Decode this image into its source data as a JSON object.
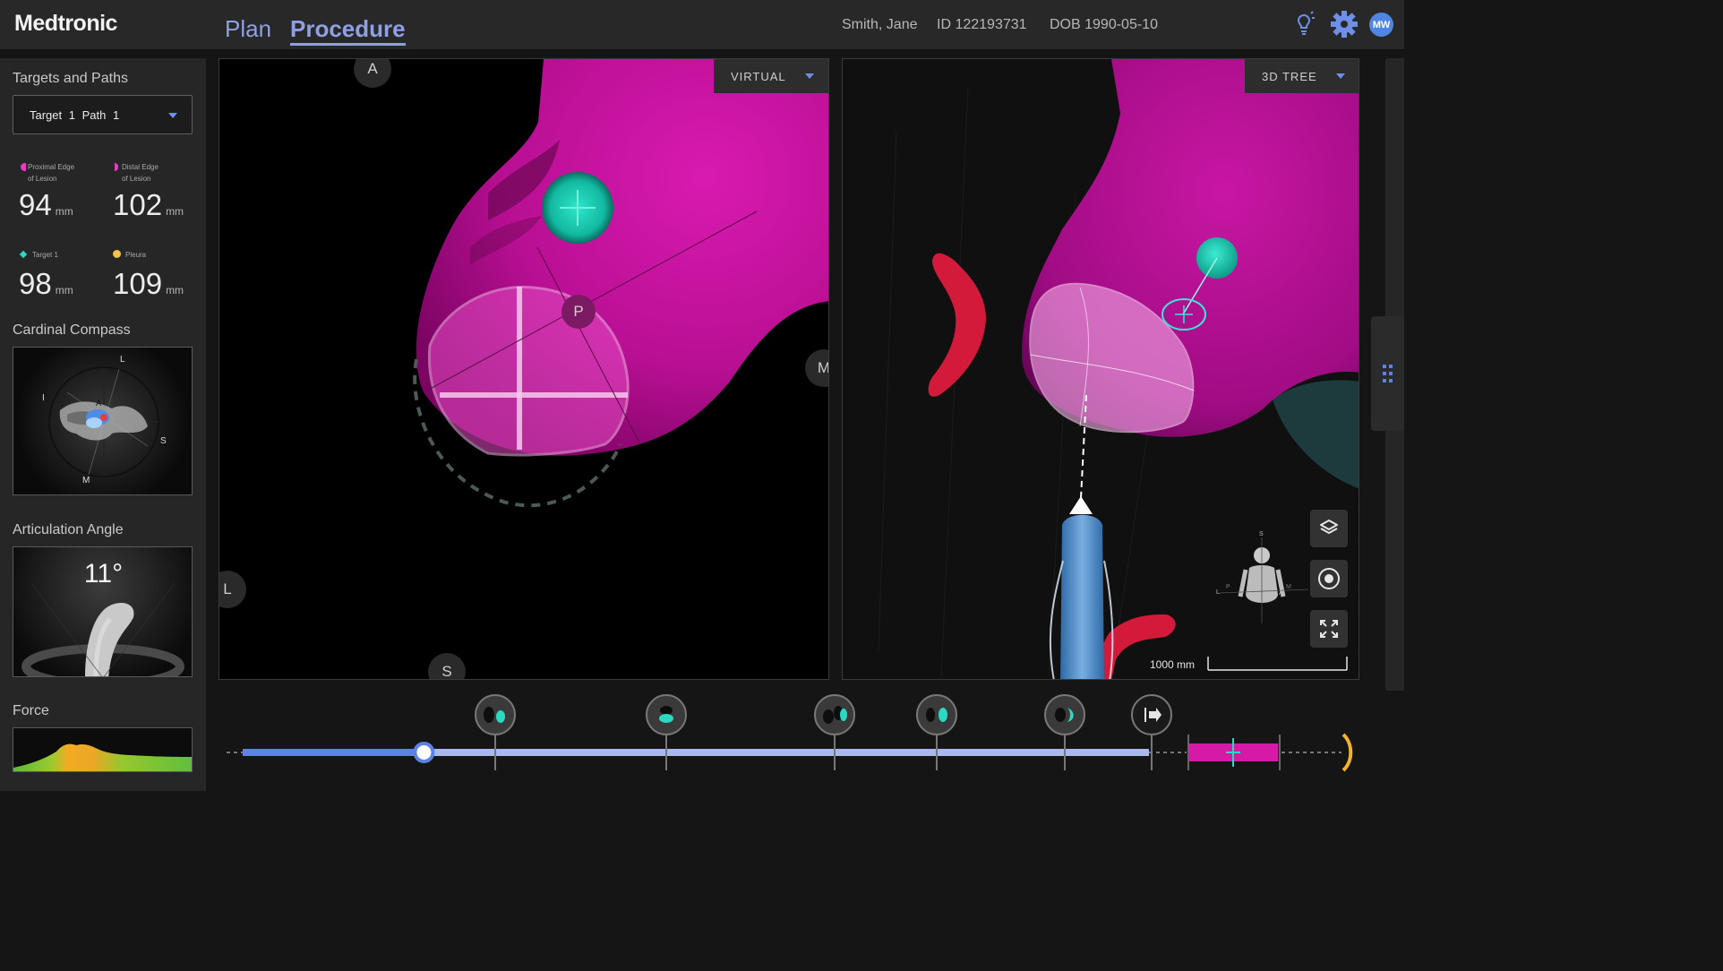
{
  "header": {
    "logo": "Medtronic",
    "tabs": [
      {
        "label": "Plan"
      },
      {
        "label": "Procedure"
      }
    ],
    "patient_name": "Smith, Jane",
    "patient_id": "ID 122193731",
    "patient_dob": "DOB 1990-05-10",
    "user_initials": "MW"
  },
  "sidebar": {
    "targets_title": "Targets and Paths",
    "target_select": "Target 1  Path 1",
    "metrics": [
      {
        "label_line1": "Proximal Edge",
        "label_line2": "of Lesion",
        "value": "94",
        "unit": "mm",
        "color": "#e23fc0"
      },
      {
        "label_line1": "Distal Edge",
        "label_line2": "of Lesion",
        "value": "102",
        "unit": "mm",
        "color": "#e23fc0"
      },
      {
        "label_line1": "Target 1",
        "label_line2": "",
        "value": "98",
        "unit": "mm",
        "color": "#2ad9c2"
      },
      {
        "label_line1": "Pleura",
        "label_line2": "",
        "value": "109",
        "unit": "mm",
        "color": "#f3c344"
      }
    ],
    "compass_title": "Cardinal Compass",
    "compass_labels": {
      "top": "L",
      "left": "I",
      "right": "S",
      "bottom": "M",
      "center": "A"
    },
    "articulation_title": "Articulation Angle",
    "articulation_value": "11°",
    "force_title": "Force"
  },
  "virtual_view": {
    "mode": "VIRTUAL",
    "orientation": {
      "top": "A",
      "right": "M",
      "bottom": "S",
      "left": "L",
      "center": "P"
    }
  },
  "tree_view": {
    "mode": "3D TREE",
    "scale_label": "1000 mm",
    "mini_axes": {
      "top": "S",
      "left": "L",
      "p": "P",
      "m": "M",
      "a": "A"
    }
  },
  "timeline": {
    "progress_fraction": 0.2,
    "waypoints": [
      "airway-1",
      "airway-2",
      "airway-3",
      "airway-4",
      "airway-5",
      "exit"
    ]
  },
  "colors": {
    "accent": "#6e8fe8",
    "lesion": "#d41aa6",
    "target": "#2ad9c2",
    "pleura": "#f3c344",
    "vessel": "#d31a3a"
  }
}
